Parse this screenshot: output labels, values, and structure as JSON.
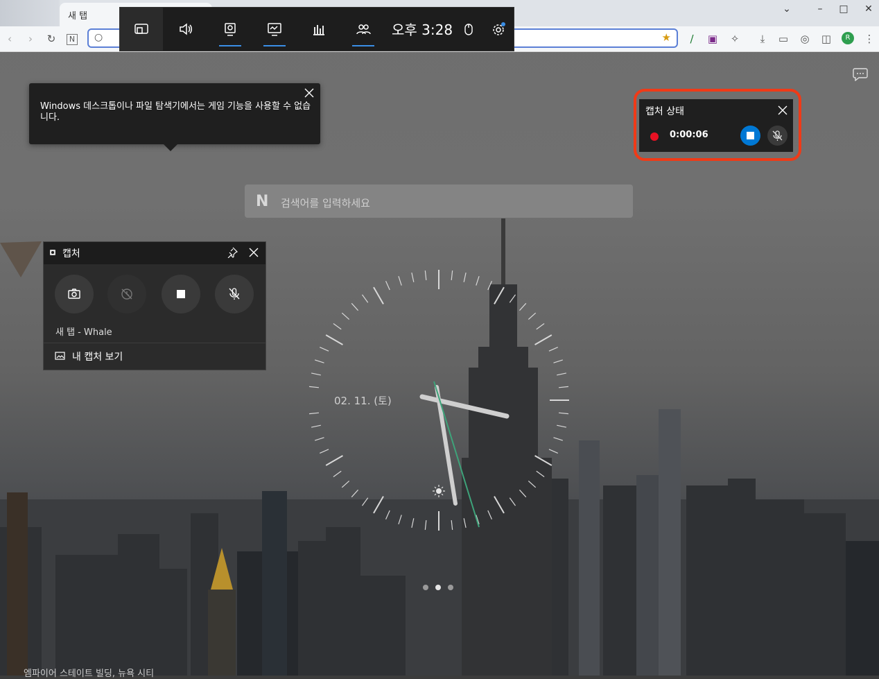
{
  "browser": {
    "tab_title": "새 탭",
    "address_placeholder": ""
  },
  "game_bar": {
    "time": "오후 3:28",
    "buttons": [
      "widget-menu-icon",
      "audio-icon",
      "capture-icon",
      "performance-icon",
      "resources-icon",
      "social-icon"
    ],
    "accent_color": "#3a8ee6"
  },
  "tooltip": {
    "message": "Windows 데스크톱이나 파일 탐색기에서는 게임 기능을 사용할 수 없습니다."
  },
  "capture_status": {
    "title": "캡처 상태",
    "elapsed": "0:00:06",
    "highlight_color": "#f03a17",
    "record_dot_color": "#e81123",
    "stop_color": "#0078d4"
  },
  "search": {
    "logo": "N",
    "placeholder": "검색어를 입력하세요"
  },
  "capture_widget": {
    "title": "캡처",
    "app_name": "새 탭 - Whale",
    "gallery_label": "내 캡처 보기"
  },
  "clock": {
    "date": "02. 11. (토)"
  },
  "footer": {
    "city": "엠파이어 스테이트 빌딩, 뉴욕 시티"
  }
}
